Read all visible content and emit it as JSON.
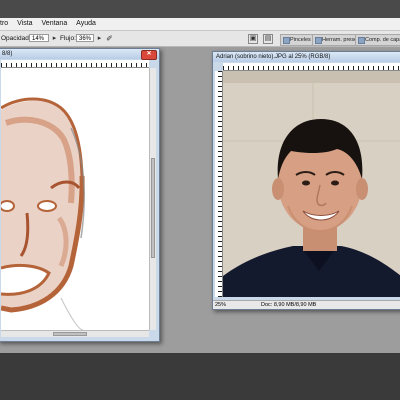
{
  "menu": [
    "tro",
    "Vista",
    "Ventana",
    "Ayuda"
  ],
  "options": {
    "opacity_label": "Opacidad:",
    "opacity_value": "14%",
    "flow_label": "Flujo:",
    "flow_value": "36%"
  },
  "panels": [
    "Pinceles",
    "Herram. presel.",
    "Comp. de capas"
  ],
  "left_window": {
    "title": "8/8)",
    "zoom": "",
    "doc": ""
  },
  "right_window": {
    "title": "Adrian (sobrino nieto).JPG al 25% (RGB/8)",
    "zoom": "25%",
    "doc": "Doc: 8,90 MB/8,90 MB"
  },
  "colors": {
    "workspace": "#9d9d9d",
    "window_frame": "#c9d9ea",
    "sketch_stroke": "#b5643a",
    "photo_bg": "#d8d0c2",
    "shirt": "#141a2e"
  },
  "icons": [
    "airbrush-icon",
    "screen-mode-icon",
    "panel-icon",
    "close-icon"
  ]
}
